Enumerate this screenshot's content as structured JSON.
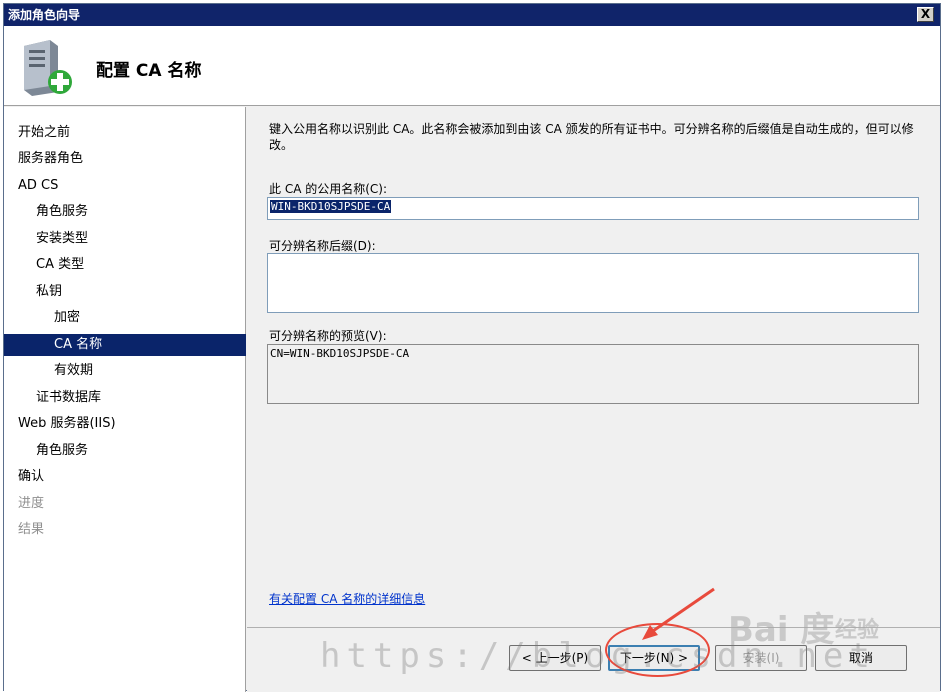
{
  "window": {
    "title": "添加角色向导",
    "close_label": "X"
  },
  "header": {
    "page_title": "配置 CA 名称",
    "icon": "server-add-icon"
  },
  "sidebar": {
    "items": [
      {
        "label": "开始之前",
        "state": "normal"
      },
      {
        "label": "服务器角色",
        "state": "normal"
      },
      {
        "label": "AD CS",
        "state": "normal"
      },
      {
        "label": "角色服务",
        "state": "normal"
      },
      {
        "label": "安装类型",
        "state": "normal"
      },
      {
        "label": "CA 类型",
        "state": "normal"
      },
      {
        "label": "私钥",
        "state": "normal"
      },
      {
        "label": "加密",
        "state": "normal"
      },
      {
        "label": "CA 名称",
        "state": "selected"
      },
      {
        "label": "有效期",
        "state": "normal"
      },
      {
        "label": "证书数据库",
        "state": "normal"
      },
      {
        "label": "Web 服务器(IIS)",
        "state": "normal"
      },
      {
        "label": "角色服务",
        "state": "normal"
      },
      {
        "label": "确认",
        "state": "normal"
      },
      {
        "label": "进度",
        "state": "disabled"
      },
      {
        "label": "结果",
        "state": "disabled"
      }
    ]
  },
  "main": {
    "description": "键入公用名称以识别此 CA。此名称会被添加到由该 CA 颁发的所有证书中。可分辨名称的后缀值是自动生成的，但可以修改。",
    "common_name_label": "此 CA 的公用名称(C):",
    "common_name_value": "WIN-BKD10SJPSDE-CA",
    "dn_suffix_label": "可分辨名称后缀(D):",
    "dn_suffix_value": "",
    "dn_preview_label": "可分辨名称的预览(V):",
    "dn_preview_value": "CN=WIN-BKD10SJPSDE-CA",
    "help_link": "有关配置 CA 名称的详细信息"
  },
  "footer": {
    "prev_button": "< 上一步(P)",
    "next_button": "下一步(N) >",
    "install_button": "安装(I)",
    "cancel_button": "取消"
  },
  "watermark": {
    "url": "https://blog.csdn.net",
    "brand": "Bai 度",
    "sub": "经验"
  },
  "colors": {
    "title_bar": "#10246a",
    "selection": "#0a246a",
    "annotation": "#e84a3c"
  }
}
